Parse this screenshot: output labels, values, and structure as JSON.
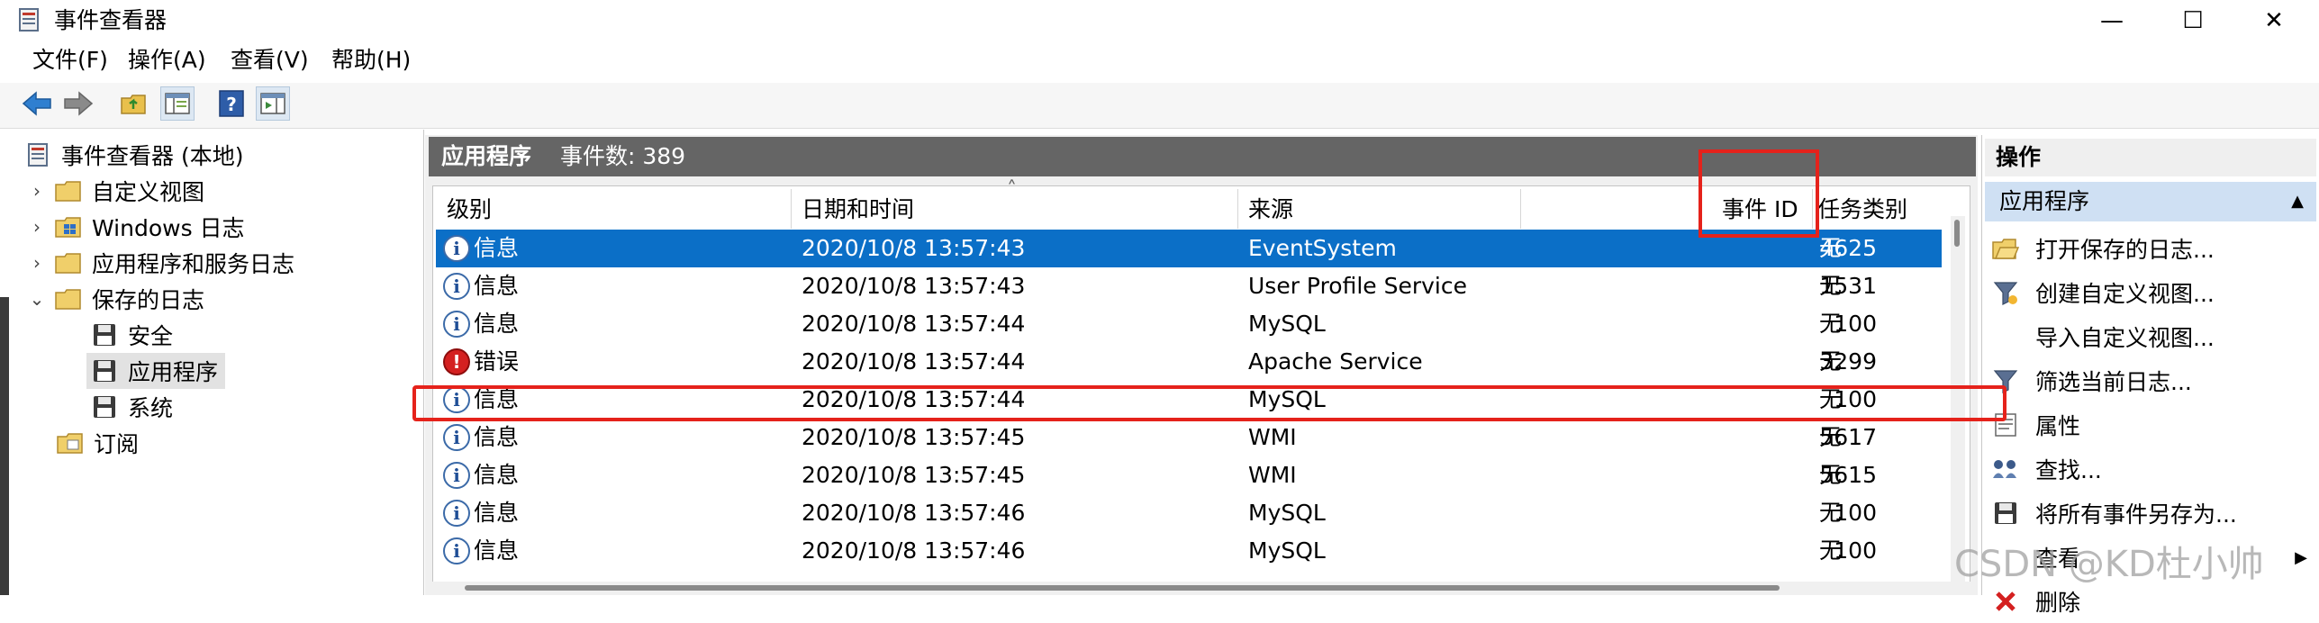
{
  "window": {
    "title": "事件查看器",
    "controls": {
      "minimize": "—",
      "maximize": "☐",
      "close": "✕"
    }
  },
  "menu": [
    "文件(F)",
    "操作(A)",
    "查看(V)",
    "帮助(H)"
  ],
  "toolbar": [
    "back-arrow-icon",
    "forward-arrow-icon",
    "folder-up-icon",
    "console-tree-icon",
    "help-icon",
    "action-pane-icon"
  ],
  "tree": {
    "root": "事件查看器 (本地)",
    "items": [
      {
        "label": "自定义视图",
        "expander": "›"
      },
      {
        "label": "Windows 日志",
        "expander": "›"
      },
      {
        "label": "应用程序和服务日志",
        "expander": "›"
      },
      {
        "label": "保存的日志",
        "expander": "⌄"
      }
    ],
    "saved_logs": [
      "安全",
      "应用程序",
      "系统"
    ],
    "subscriptions": "订阅"
  },
  "center": {
    "header_title": "应用程序",
    "header_count": "事件数: 389",
    "columns": [
      "级别",
      "日期和时间",
      "来源",
      "事件 ID",
      "任务类别"
    ],
    "sort_indicator": "˄",
    "rows": [
      {
        "level": "信息",
        "type": "info",
        "datetime": "2020/10/8 13:57:43",
        "source": "EventSystem",
        "id": "4625",
        "task": "无"
      },
      {
        "level": "信息",
        "type": "info",
        "datetime": "2020/10/8 13:57:43",
        "source": "User Profile Service",
        "id": "1531",
        "task": "无"
      },
      {
        "level": "信息",
        "type": "info",
        "datetime": "2020/10/8 13:57:44",
        "source": "MySQL",
        "id": "100",
        "task": "无"
      },
      {
        "level": "错误",
        "type": "error",
        "datetime": "2020/10/8 13:57:44",
        "source": "Apache Service",
        "id": "3299",
        "task": "无"
      },
      {
        "level": "信息",
        "type": "info",
        "datetime": "2020/10/8 13:57:44",
        "source": "MySQL",
        "id": "100",
        "task": "无"
      },
      {
        "level": "信息",
        "type": "info",
        "datetime": "2020/10/8 13:57:45",
        "source": "WMI",
        "id": "5617",
        "task": "无"
      },
      {
        "level": "信息",
        "type": "info",
        "datetime": "2020/10/8 13:57:45",
        "source": "WMI",
        "id": "5615",
        "task": "无"
      },
      {
        "level": "信息",
        "type": "info",
        "datetime": "2020/10/8 13:57:46",
        "source": "MySQL",
        "id": "100",
        "task": "无"
      },
      {
        "level": "信息",
        "type": "info",
        "datetime": "2020/10/8 13:57:46",
        "source": "MySQL",
        "id": "100",
        "task": "无"
      }
    ]
  },
  "actions": {
    "header": "操作",
    "section": "应用程序",
    "collapse_glyph": "▲",
    "items": [
      {
        "label": "打开保存的日志...",
        "icon": "open-folder-icon"
      },
      {
        "label": "创建自定义视图...",
        "icon": "filter-create-icon"
      },
      {
        "label": "导入自定义视图...",
        "icon": ""
      },
      {
        "label": "筛选当前日志...",
        "icon": "filter-icon"
      },
      {
        "label": "属性",
        "icon": "properties-icon"
      },
      {
        "label": "查找...",
        "icon": "find-icon"
      },
      {
        "label": "将所有事件另存为...",
        "icon": "save-icon"
      },
      {
        "label": "查看",
        "icon": "",
        "arrow": "▶"
      },
      {
        "label": "删除",
        "icon": "delete-icon"
      }
    ]
  },
  "watermark": "CSDN @KD杜小帅",
  "colors": {
    "selection": "#0b6fc7",
    "header": "#656565",
    "annotation": "#e5221b",
    "action_section": "#cfe0f3"
  }
}
